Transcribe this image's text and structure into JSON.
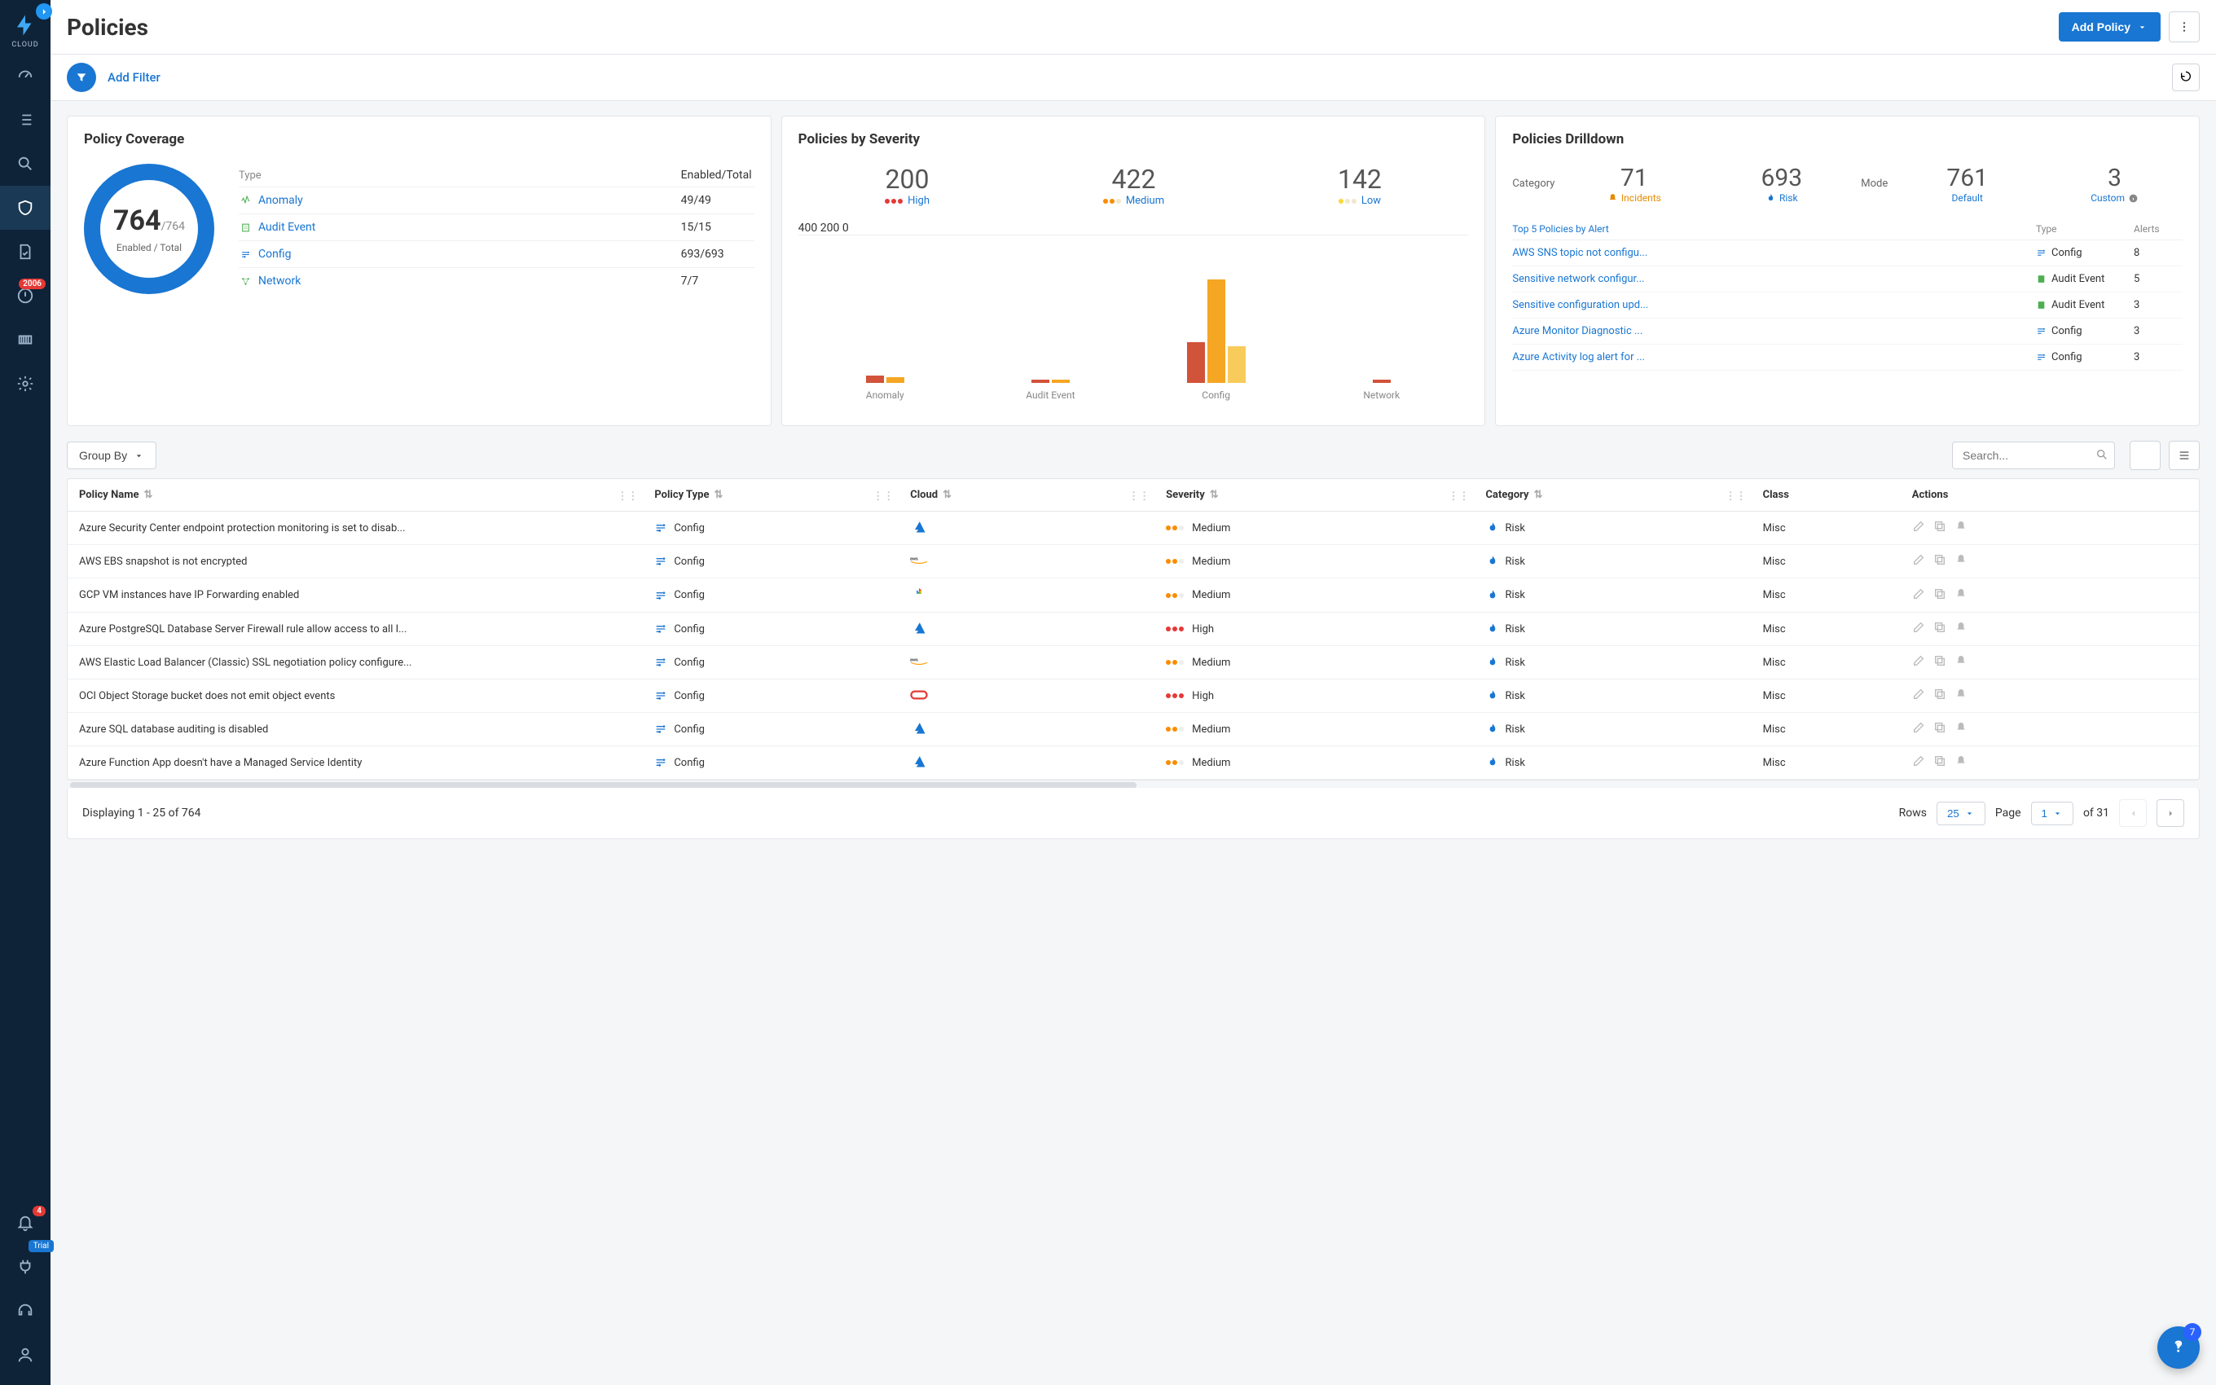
{
  "brand": {
    "name": "CLOUD"
  },
  "sidebar": {
    "alerts_badge": "2006",
    "bell_badge": "4",
    "trial_label": "Trial"
  },
  "header": {
    "title": "Policies",
    "add_policy_label": "Add Policy"
  },
  "filter_bar": {
    "add_filter_label": "Add Filter"
  },
  "coverage_card": {
    "title": "Policy Coverage",
    "enabled": "764",
    "total_suffix": "/764",
    "sub_label": "Enabled / Total",
    "col_type": "Type",
    "col_enabled": "Enabled/Total",
    "rows": [
      {
        "name": "Anomaly",
        "value": "49/49",
        "color": "#4caf50"
      },
      {
        "name": "Audit Event",
        "value": "15/15",
        "color": "#4caf50"
      },
      {
        "name": "Config",
        "value": "693/693",
        "color": "#1976d2"
      },
      {
        "name": "Network",
        "value": "7/7",
        "color": "#4caf50"
      }
    ]
  },
  "severity_card": {
    "title": "Policies by Severity",
    "stats": [
      {
        "num": "200",
        "label": "High"
      },
      {
        "num": "422",
        "label": "Medium"
      },
      {
        "num": "142",
        "label": "Low"
      }
    ]
  },
  "drilldown_card": {
    "title": "Policies Drilldown",
    "category_label": "Category",
    "mode_label": "Mode",
    "category_stats": [
      {
        "num": "71",
        "label": "Incidents",
        "kind": "warn"
      },
      {
        "num": "693",
        "label": "Risk",
        "kind": "risk"
      }
    ],
    "mode_stats": [
      {
        "num": "761",
        "label": "Default"
      },
      {
        "num": "3",
        "label": "Custom"
      }
    ],
    "col_a": "Top 5 Policies by Alert",
    "col_b": "Type",
    "col_c": "Alerts",
    "rows": [
      {
        "name": "AWS SNS topic not configu...",
        "type": "Config",
        "type_icon": "config",
        "alerts": "8"
      },
      {
        "name": "Sensitive network configur...",
        "type": "Audit Event",
        "type_icon": "audit",
        "alerts": "5"
      },
      {
        "name": "Sensitive configuration upd...",
        "type": "Audit Event",
        "type_icon": "audit",
        "alerts": "3"
      },
      {
        "name": "Azure Monitor Diagnostic ...",
        "type": "Config",
        "type_icon": "config",
        "alerts": "3"
      },
      {
        "name": "Azure Activity log alert for ...",
        "type": "Config",
        "type_icon": "config",
        "alerts": "3"
      }
    ]
  },
  "toolbar": {
    "group_by_label": "Group By",
    "search_placeholder": "Search..."
  },
  "table": {
    "columns": {
      "policy_name": "Policy Name",
      "policy_type": "Policy Type",
      "cloud": "Cloud",
      "severity": "Severity",
      "category": "Category",
      "class": "Class",
      "actions": "Actions"
    },
    "rows": [
      {
        "name": "Azure Security Center endpoint protection monitoring is set to disab...",
        "type": "Config",
        "cloud": "azure",
        "severity": "Medium",
        "severity_level": "med",
        "category": "Risk",
        "class_": "Misc"
      },
      {
        "name": "AWS EBS snapshot is not encrypted",
        "type": "Config",
        "cloud": "aws",
        "severity": "Medium",
        "severity_level": "med",
        "category": "Risk",
        "class_": "Misc"
      },
      {
        "name": "GCP VM instances have IP Forwarding enabled",
        "type": "Config",
        "cloud": "gcp",
        "severity": "Medium",
        "severity_level": "med",
        "category": "Risk",
        "class_": "Misc"
      },
      {
        "name": "Azure PostgreSQL Database Server Firewall rule allow access to all I...",
        "type": "Config",
        "cloud": "azure",
        "severity": "High",
        "severity_level": "high",
        "category": "Risk",
        "class_": "Misc"
      },
      {
        "name": "AWS Elastic Load Balancer (Classic) SSL negotiation policy configure...",
        "type": "Config",
        "cloud": "aws",
        "severity": "Medium",
        "severity_level": "med",
        "category": "Risk",
        "class_": "Misc"
      },
      {
        "name": "OCI Object Storage bucket does not emit object events",
        "type": "Config",
        "cloud": "oci",
        "severity": "High",
        "severity_level": "high",
        "category": "Risk",
        "class_": "Misc"
      },
      {
        "name": "Azure SQL database auditing is disabled",
        "type": "Config",
        "cloud": "azure",
        "severity": "Medium",
        "severity_level": "med",
        "category": "Risk",
        "class_": "Misc"
      },
      {
        "name": "Azure Function App doesn't have a Managed Service Identity",
        "type": "Config",
        "cloud": "azure",
        "severity": "Medium",
        "severity_level": "med",
        "category": "Risk",
        "class_": "Misc"
      }
    ]
  },
  "pager": {
    "display_text": "Displaying 1 - 25 of 764",
    "rows_label": "Rows",
    "rows_value": "25",
    "page_label": "Page",
    "page_value": "1",
    "of_text": "of 31"
  },
  "fab": {
    "badge": "7"
  },
  "chart_data": {
    "type": "bar",
    "title": "Policies by Severity",
    "xlabel": "",
    "ylabel": "",
    "ylim": [
      0,
      500
    ],
    "yTicks": [
      0,
      200,
      400
    ],
    "categories": [
      "Anomaly",
      "Audit Event",
      "Config",
      "Network"
    ],
    "series": [
      {
        "name": "High",
        "color": "#d1533a",
        "values": [
          28,
          10,
          155,
          7
        ]
      },
      {
        "name": "Medium",
        "color": "#f5a623",
        "values": [
          21,
          5,
          396,
          0
        ]
      },
      {
        "name": "Low",
        "color": "#f8cc5a",
        "values": [
          0,
          0,
          142,
          0
        ]
      }
    ]
  }
}
